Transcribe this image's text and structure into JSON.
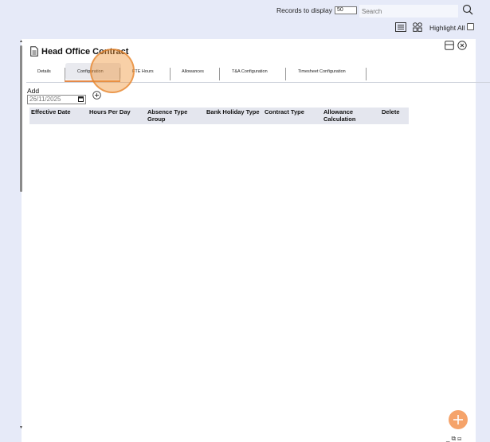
{
  "toolbar": {
    "records_label": "Records to display",
    "records_value": "50",
    "search_placeholder": "Search",
    "highlight_label": "Highlight All"
  },
  "panel": {
    "title": "Head Office Contract",
    "tabs": [
      {
        "label": "Details"
      },
      {
        "label": "Configuration"
      },
      {
        "label": "FTE Hours"
      },
      {
        "label": "Allowances"
      },
      {
        "label": "T&A Configuration"
      },
      {
        "label": "Timesheet Configuration"
      }
    ],
    "active_tab": "Configuration",
    "add_label": "Add",
    "date_value": "26/11/2025"
  },
  "table": {
    "columns": [
      "Effective Date",
      "Hours Per Day",
      "Absence Type Group",
      "Bank Holiday Type",
      "Contract Type",
      "Allowance Calculation",
      "Delete"
    ]
  },
  "icons": {
    "search": "search-icon",
    "list": "list-view-icon",
    "grid": "grid-view-icon",
    "document": "document-icon",
    "calendar": "calendar-icon",
    "add": "add-circle-icon",
    "panel": "panel-layout-icon",
    "close": "close-circle-icon",
    "fab": "plus-icon"
  },
  "colors": {
    "accent": "#e48a4a",
    "fab": "#f5a36a",
    "background": "#e6eaf8"
  }
}
